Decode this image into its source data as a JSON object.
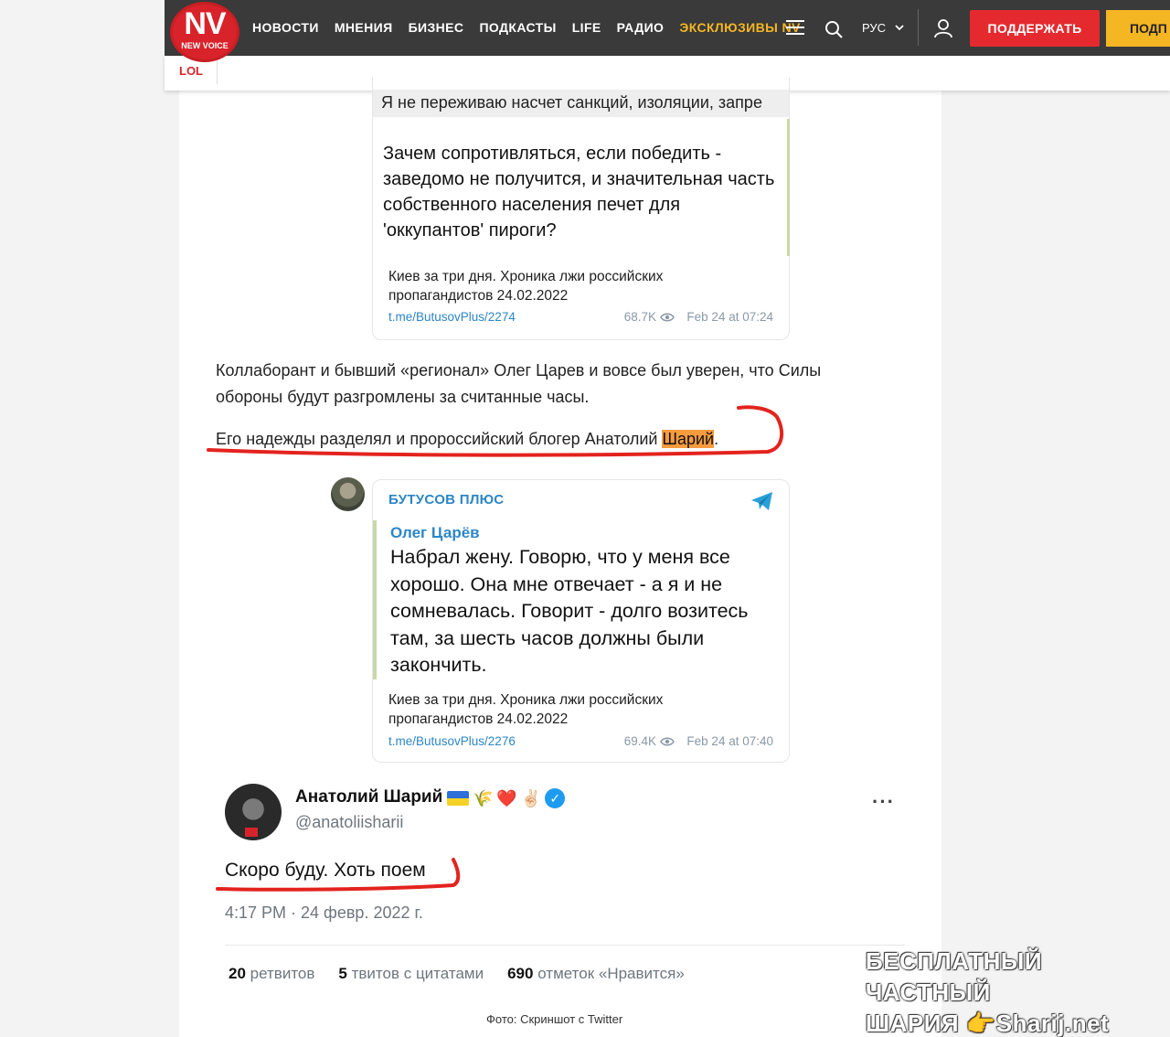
{
  "header": {
    "logo": {
      "main": "NV",
      "sub": "NEW VOICE"
    },
    "section": "LOL",
    "nav": [
      "НОВОСТИ",
      "МНЕНИЯ",
      "БИЗНЕС",
      "ПОДКАСТЫ",
      "LIFE",
      "РАДИО",
      "ЭКСКЛЮЗИВЫ NV"
    ],
    "lang": "РУС",
    "support_label": "ПОДДЕРЖАТЬ",
    "subscribe_label": "ПОДП",
    "colors": {
      "topbar": "#3a3a3a",
      "accent_red": "#e52a2f",
      "accent_yellow": "#f5b623"
    }
  },
  "embed1": {
    "quote": "Я не переживаю насчет санкций, изоляции, запре",
    "body": "Зачем сопротивляться, если победить - заведомо не получится, и значительная часть собственного населения печет для 'оккупантов' пироги?",
    "caption": "Киев за три дня. Хроника лжи российских пропагандистов 24.02.2022",
    "link": "t.me/ButusovPlus/2274",
    "views": "68.7K",
    "date": "Feb 24 at 07:24"
  },
  "article": {
    "p1": "Коллаборант и бывший «регионал» Олег Царев и вовсе был уверен, что Силы обороны будут разгромлены за считанные часы.",
    "p2_pre": "Его надежды разделял и пророссийский блогер Анатолий ",
    "p2_hl": "Шарий",
    "p2_post": "."
  },
  "embed2": {
    "channel": "БУТУСОВ ПЛЮС",
    "author": "Олег Царёв",
    "body": "Набрал жену. Говорю, что у меня все хорошо. Она мне отвечает - а я и не сомневалась. Говорит - долго возитесь там, за шесть часов должны были закончить.",
    "caption": "Киев за три дня. Хроника лжи российских пропагандистов 24.02.2022",
    "link": "t.me/ButusovPlus/2276",
    "views": "69.4K",
    "date": "Feb 24 at 07:40"
  },
  "tweet": {
    "name": "Анатолий Шарий",
    "emojis": [
      "🌾",
      "❤️",
      "✌🏻"
    ],
    "handle": "@anatoliisharii",
    "more": "···",
    "text": "Скоро буду. Хоть поем",
    "time": "4:17 PM · 24 февр. 2022 г.",
    "stats": [
      {
        "num": "20",
        "label": "ретвитов"
      },
      {
        "num": "5",
        "label": "твитов с цитатами"
      },
      {
        "num": "690",
        "label": "отметок «Нравится»"
      }
    ]
  },
  "photo_caption": "Фото: Скриншот с Twitter",
  "watermark": {
    "line1": "БЕСПЛАТНЫЙ ЧАСТНЫЙ",
    "line2a": "ШАРИЯ",
    "line2b": "Sharij.net"
  }
}
